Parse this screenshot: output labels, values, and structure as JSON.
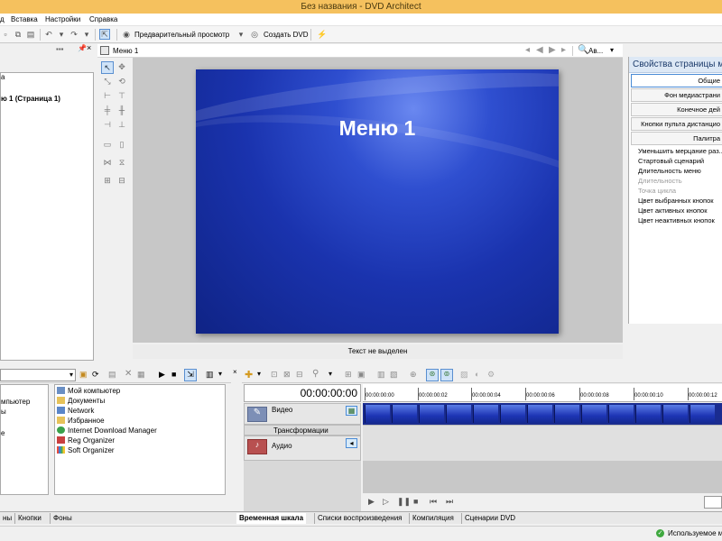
{
  "window": {
    "title": "Без названия - DVD Architect"
  },
  "menubar": {
    "items": [
      "д",
      "Вставка",
      "Настройки",
      "Справка"
    ]
  },
  "toolbar": {
    "preview_label": "Предварительный просмотр",
    "create_dvd_label": "Создать DVD"
  },
  "project_tree": {
    "items": [
      "а",
      "ю 1 (Страница 1)"
    ]
  },
  "editor": {
    "tab_title": "Меню 1",
    "zoom_label": "Ав...",
    "menu_heading": "Меню 1",
    "status_text": "Текст не выделен"
  },
  "properties": {
    "title": "Свойства страницы м",
    "tabs": [
      "Общие",
      "Фон медиастрани",
      "Конечное дей",
      "Кнопки пульта дистанцио",
      "Палитра"
    ],
    "rows": [
      {
        "label": "Уменьшить мерцание раз...",
        "disabled": false
      },
      {
        "label": "Стартовый сценарий",
        "disabled": false
      },
      {
        "label": "Длительность меню",
        "disabled": false
      },
      {
        "label": "Длительность",
        "disabled": true
      },
      {
        "label": "Точка цикла",
        "disabled": true
      },
      {
        "label": "Цвет выбранных кнопок",
        "disabled": false
      },
      {
        "label": "Цвет активных кнопок",
        "disabled": false
      },
      {
        "label": "Цвет неактивных кнопок",
        "disabled": false
      }
    ]
  },
  "explorer": {
    "left_items": [
      "мпьютер",
      "ы",
      "е"
    ],
    "right_items": [
      {
        "label": "Мой компьютер",
        "icon": "computer-icon",
        "color": "#6a8fc4"
      },
      {
        "label": "Документы",
        "icon": "folder-icon",
        "color": "#e6c25a"
      },
      {
        "label": "Network",
        "icon": "network-icon",
        "color": "#5a86c9"
      },
      {
        "label": "Избранное",
        "icon": "favorites-folder-icon",
        "color": "#e6c25a"
      },
      {
        "label": "Internet Download Manager",
        "icon": "idm-icon",
        "color": "#3aa04a"
      },
      {
        "label": "Reg Organizer",
        "icon": "reg-organizer-icon",
        "color": "#c94040"
      },
      {
        "label": "Soft Organizer",
        "icon": "soft-organizer-icon",
        "color": "#3c7ed8"
      }
    ],
    "tabs": [
      "ны",
      "Кнопки",
      "Фоны"
    ]
  },
  "timeline": {
    "time": "00:00:00:00",
    "ruler": [
      "00:00:00:00",
      "00:00:00:02",
      "00:00:00:04",
      "00:00:00:06",
      "00:00:00:08",
      "00:00:00:10",
      "00:00:00:12"
    ],
    "video_track": "Видео",
    "transform_label": "Трансформации",
    "audio_track": "Аудио",
    "tabs": [
      "Временная шкала",
      "Списки воспроизведения",
      "Компиляция",
      "Сценарии DVD"
    ]
  },
  "statusbar": {
    "text": "Используемое мес"
  }
}
